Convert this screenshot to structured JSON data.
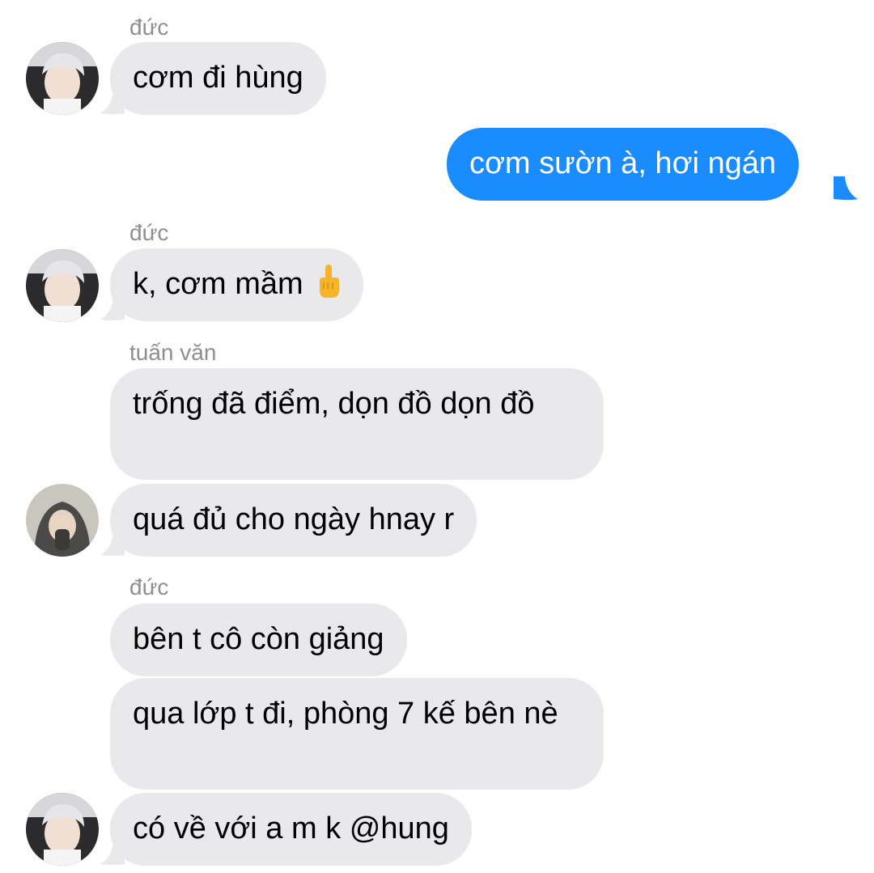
{
  "messages": [
    {
      "sender": "đức",
      "text": "cơm đi hùng"
    },
    {
      "text": "cơm sườn à, hơi ngán",
      "outgoing": true
    },
    {
      "sender": "đức",
      "text": "k, cơm mầm",
      "emoji": "middle-finger-emoji"
    },
    {
      "sender": "tuấn văn",
      "text": "trống đã điểm, dọn đồ dọn đồ"
    },
    {
      "text": "quá đủ cho ngày hnay r"
    },
    {
      "sender": "đức",
      "text": "bên t cô còn giảng"
    },
    {
      "text": "qua lớp t đi, phòng 7 kế bên nè"
    },
    {
      "text": "có về với a m k @hung"
    }
  ],
  "colors": {
    "incoming_bubble": "#e9e9eb",
    "outgoing_bubble": "#1a8cff",
    "sender_label": "#8e8e93"
  }
}
